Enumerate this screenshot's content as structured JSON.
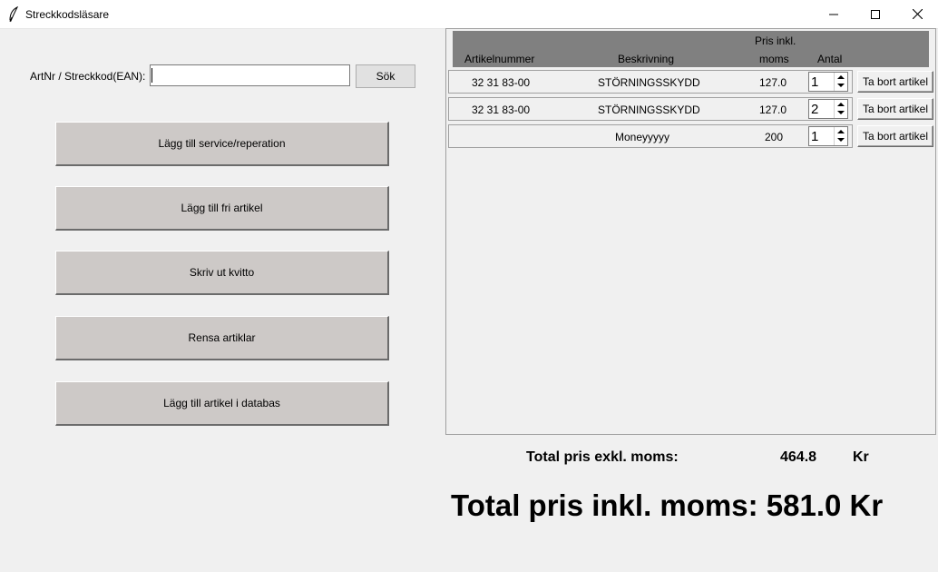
{
  "window": {
    "title": "Streckkodsläsare"
  },
  "search": {
    "label": "ArtNr / Streckkod(EAN):",
    "value": "",
    "button_label": "Sök"
  },
  "actions": [
    {
      "label": "Lägg till service/reperation"
    },
    {
      "label": "Lägg till fri artikel"
    },
    {
      "label": "Skriv ut kvitto"
    },
    {
      "label": "Rensa artiklar"
    },
    {
      "label": "Lägg till artikel i databas"
    }
  ],
  "table": {
    "headers": {
      "artikelnummer": "Artikelnummer",
      "beskrivning": "Beskrivning",
      "pris_line1": "Pris inkl.",
      "pris_line2": "moms",
      "antal": "Antal"
    },
    "rows": [
      {
        "artikelnummer": "32 31 83-00",
        "beskrivning": "STÖRNINGSSKYDD",
        "pris": "127.0",
        "antal": "1",
        "remove_label": "Ta bort artikel"
      },
      {
        "artikelnummer": "32 31 83-00",
        "beskrivning": "STÖRNINGSSKYDD",
        "pris": "127.0",
        "antal": "2",
        "remove_label": "Ta bort artikel"
      },
      {
        "artikelnummer": "",
        "beskrivning": "Moneyyyyy",
        "pris": "200",
        "antal": "1",
        "remove_label": "Ta bort artikel"
      }
    ]
  },
  "totals": {
    "excl_label": "Total pris exkl. moms:",
    "excl_value": "464.8",
    "excl_unit": "Kr",
    "incl_text": "Total pris inkl. moms: 581.0 Kr"
  }
}
